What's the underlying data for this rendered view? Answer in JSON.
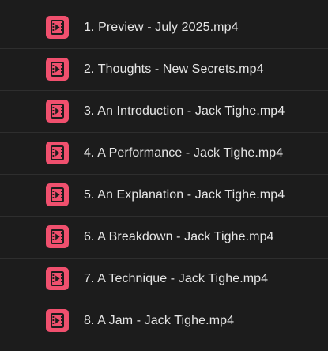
{
  "file_icon": {
    "name": "video-file-icon",
    "color": "#f0506e",
    "glyph_color": "#1c1c1c"
  },
  "files": [
    {
      "name": "1. Preview - July 2025.mp4"
    },
    {
      "name": "2. Thoughts - New Secrets.mp4"
    },
    {
      "name": "3. An Introduction - Jack Tighe.mp4"
    },
    {
      "name": "4. A Performance - Jack Tighe.mp4"
    },
    {
      "name": "5. An Explanation - Jack Tighe.mp4"
    },
    {
      "name": "6. A Breakdown - Jack Tighe.mp4"
    },
    {
      "name": "7. A Technique - Jack Tighe.mp4"
    },
    {
      "name": "8. A Jam - Jack Tighe.mp4"
    }
  ]
}
